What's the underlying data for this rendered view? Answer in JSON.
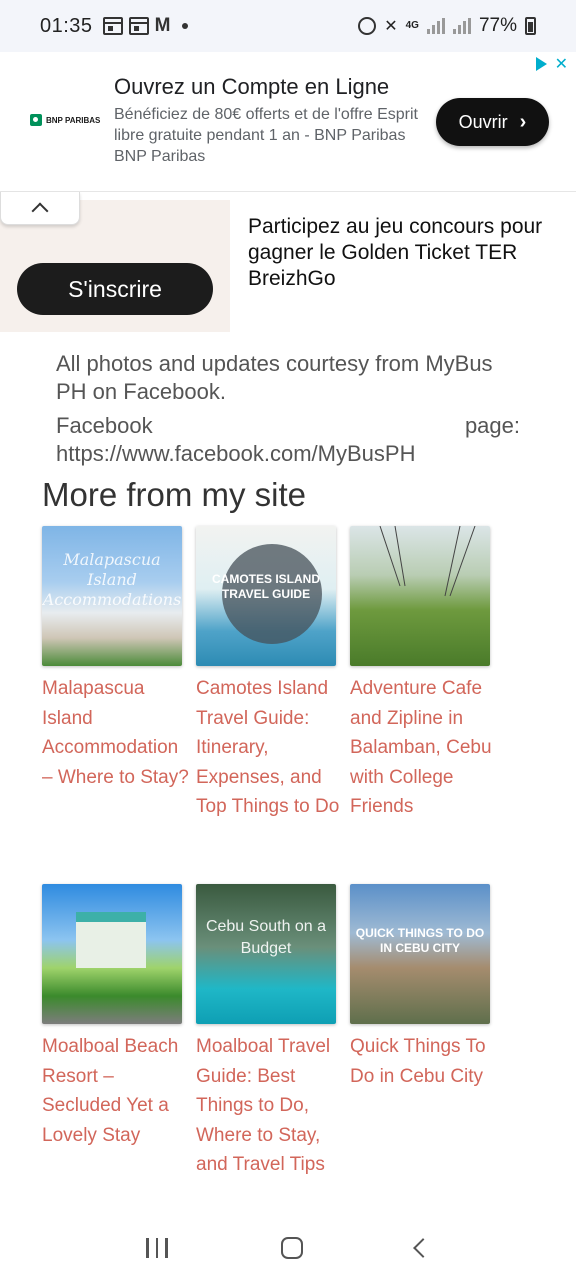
{
  "status_bar": {
    "time": "01:35",
    "network": "4G",
    "battery": "77%"
  },
  "ad": {
    "advertiser": "BNP PARIBAS",
    "title": "Ouvrez un Compte en Ligne",
    "body": "Bénéficiez de 80€ offerts et de l'offre Esprit libre gratuite pendant 1 an - BNP Paribas BNP Paribas",
    "cta_label": "Ouvrir"
  },
  "promo": {
    "signup_label": "S'inscrire",
    "text": "Participez au jeu concours pour gagner le Golden Ticket TER BreizhGo"
  },
  "article": {
    "credit_text": "All photos and updates courtesy from MyBus PH on Facebook.",
    "facebook_label": "Facebook",
    "page_label": "page:",
    "facebook_url": "https://www.facebook.com/MyBusPH"
  },
  "related": {
    "heading": "More from my site",
    "items": [
      {
        "title": "Malapascua Island Accommodation – Where to Stay?",
        "thumb_caption": "Malapascua Island Accommodations"
      },
      {
        "title": "Camotes Island Travel Guide: Itinerary, Expenses, and Top Things to Do",
        "thumb_caption": "CAMOTES ISLAND TRAVEL GUIDE"
      },
      {
        "title": "Adventure Cafe and Zipline in Balamban, Cebu with College Friends",
        "thumb_caption": ""
      },
      {
        "title": "Moalboal Beach Resort – Secluded Yet a Lovely Stay",
        "thumb_caption": ""
      },
      {
        "title": "Moalboal Travel Guide: Best Things to Do, Where to Stay, and Travel Tips",
        "thumb_caption": "Cebu South on a Budget"
      },
      {
        "title": "Quick Things To Do in Cebu City",
        "thumb_caption": "QUICK THINGS TO DO IN CEBU CITY"
      }
    ]
  },
  "colors": {
    "link": "#d2665a",
    "ad_button": "#111111",
    "ad_choices": "#00aecd"
  }
}
